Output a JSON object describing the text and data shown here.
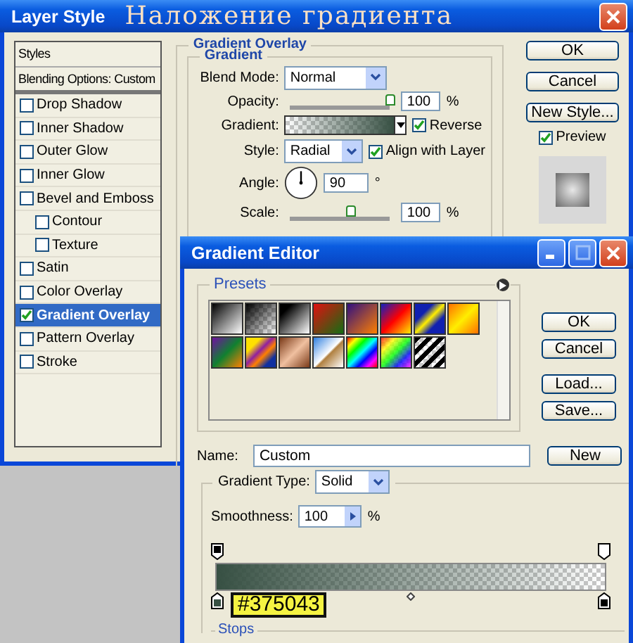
{
  "layer_style": {
    "title": "Layer Style",
    "caption": "Наложение градиента",
    "styles_header": "Styles",
    "blending_options": "Blending Options: Custom",
    "styles": [
      {
        "label": "Drop Shadow",
        "checked": false,
        "selected": false
      },
      {
        "label": "Inner Shadow",
        "checked": false,
        "selected": false
      },
      {
        "label": "Outer Glow",
        "checked": false,
        "selected": false
      },
      {
        "label": "Inner Glow",
        "checked": false,
        "selected": false
      },
      {
        "label": "Bevel and Emboss",
        "checked": false,
        "selected": false,
        "children": [
          {
            "label": "Contour",
            "checked": false,
            "selected": false
          },
          {
            "label": "Texture",
            "checked": false,
            "selected": false
          }
        ]
      },
      {
        "label": "Satin",
        "checked": false,
        "selected": false
      },
      {
        "label": "Color Overlay",
        "checked": false,
        "selected": false
      },
      {
        "label": "Gradient Overlay",
        "checked": true,
        "selected": true
      },
      {
        "label": "Pattern Overlay",
        "checked": false,
        "selected": false
      },
      {
        "label": "Stroke",
        "checked": false,
        "selected": false
      }
    ],
    "section_title": "Gradient Overlay",
    "group_title": "Gradient",
    "blend_mode": {
      "label": "Blend Mode:",
      "value": "Normal"
    },
    "opacity": {
      "label": "Opacity:",
      "level": 1,
      "value": "100",
      "unit": "%"
    },
    "gradient": {
      "label": "Gradient:"
    },
    "reverse": {
      "label": "Reverse",
      "checked": true
    },
    "style": {
      "label": "Style:",
      "value": "Radial"
    },
    "align_with_layer": {
      "label": "Align with Layer",
      "checked": true
    },
    "angle": {
      "label": "Angle:",
      "value": "90",
      "unit": "°"
    },
    "scale": {
      "label": "Scale:",
      "level": 0.6,
      "value": "100",
      "unit": "%"
    },
    "buttons": [
      "OK",
      "Cancel",
      "New Style..."
    ],
    "preview": {
      "label": "Preview",
      "checked": true
    }
  },
  "gradient_editor": {
    "title": "Gradient Editor",
    "presets_label": "Presets",
    "buttons": [
      "OK",
      "Cancel",
      "Load...",
      "Save..."
    ],
    "name": {
      "label": "Name:",
      "value": "Custom"
    },
    "new_button": "New",
    "gradient_type": {
      "label": "Gradient Type:",
      "value": "Solid"
    },
    "smoothness": {
      "label": "Smoothness:",
      "value": "100",
      "unit": "%"
    },
    "stop_color_label": "#375043",
    "stops_label": "Stops"
  }
}
